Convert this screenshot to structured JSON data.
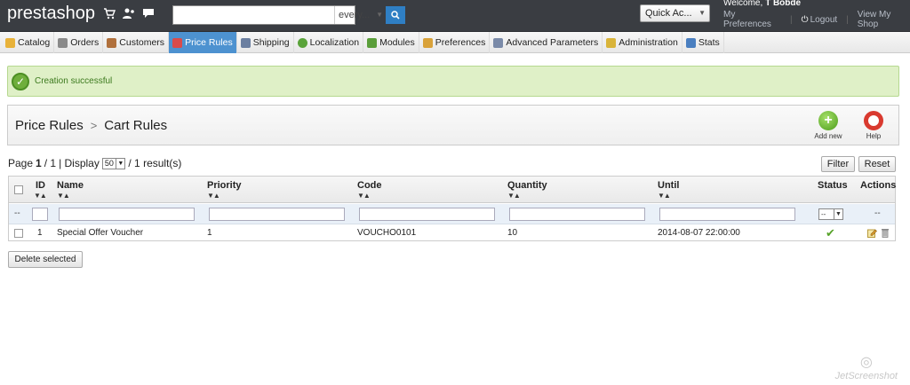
{
  "header": {
    "logo": "prestashop",
    "search": {
      "value": "",
      "scope": "every..."
    },
    "quick_access": "Quick Ac...",
    "welcome_prefix": "Welcome, ",
    "welcome_user": "T Bobde",
    "links": {
      "preferences": "My Preferences",
      "logout": "Logout",
      "view_shop": "View My Shop"
    }
  },
  "tabs": [
    {
      "label": "Catalog",
      "icon": "folder-icon",
      "color": "#e8b23a"
    },
    {
      "label": "Orders",
      "icon": "cart-icon",
      "color": "#8a8a8a"
    },
    {
      "label": "Customers",
      "icon": "customers-icon",
      "color": "#b0703c"
    },
    {
      "label": "Price Rules",
      "icon": "price-rules-icon",
      "color": "#d94b4b",
      "active": true
    },
    {
      "label": "Shipping",
      "icon": "truck-icon",
      "color": "#6b7fa0"
    },
    {
      "label": "Localization",
      "icon": "globe-icon",
      "color": "#5aa33a"
    },
    {
      "label": "Modules",
      "icon": "puzzle-icon",
      "color": "#5a9e3a"
    },
    {
      "label": "Preferences",
      "icon": "preferences-icon",
      "color": "#d9a23a"
    },
    {
      "label": "Advanced Parameters",
      "icon": "wrench-icon",
      "color": "#7a8aa8"
    },
    {
      "label": "Administration",
      "icon": "key-icon",
      "color": "#d9b43a"
    },
    {
      "label": "Stats",
      "icon": "stats-icon",
      "color": "#4a7fc0"
    }
  ],
  "alert": {
    "text": "Creation successful"
  },
  "breadcrumb": {
    "parent": "Price Rules",
    "separator": ">",
    "current": "Cart Rules"
  },
  "toolbar": {
    "add_label": "Add new",
    "help_label": "Help"
  },
  "pagination": {
    "page_label": "Page ",
    "page_current": "1",
    "page_total": " / 1",
    "display_label": " | Display ",
    "per_page": "50",
    "results": " / 1 result(s)"
  },
  "buttons": {
    "filter": "Filter",
    "reset": "Reset",
    "delete_selected": "Delete selected"
  },
  "table": {
    "columns": {
      "id": "ID",
      "name": "Name",
      "priority": "Priority",
      "code": "Code",
      "quantity": "Quantity",
      "until": "Until",
      "status": "Status",
      "actions": "Actions"
    },
    "sort_glyph": "▼▲",
    "filter_dash": "--",
    "status_select": "--",
    "rows": [
      {
        "id": "1",
        "name": "Special Offer Voucher",
        "priority": "1",
        "code": "VOUCHO0101",
        "quantity": "10",
        "until": "2014-08-07 22:00:00",
        "status": "✔"
      }
    ]
  },
  "watermark": "JetScreenshot"
}
